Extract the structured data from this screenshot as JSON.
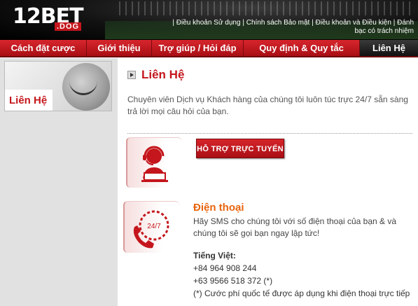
{
  "header": {
    "logo_main": "12BET",
    "logo_sub": ".DOG",
    "links": [
      "Điều khoản Sử dụng",
      "Chính sách Bảo mật",
      "Điều khoản và Điều kiện",
      "Đánh bạc có trách nhiệm"
    ]
  },
  "nav": {
    "items": [
      "Cách đặt cược",
      "Giới thiệu",
      "Trợ giúp / Hỏi đáp",
      "Quy định & Quy tắc",
      "Liên Hệ"
    ],
    "active": "Liên Hệ"
  },
  "sidebar": {
    "banner_label": "Liên Hệ"
  },
  "main": {
    "title": "Liên Hệ",
    "intro": "Chuyên viên Dịch vụ Khách hàng của chúng tôi luôn túc trực 24/7 sẵn sàng trả lời mọi câu hỏi của bạn.",
    "live_chat_button": "HỖ TRỢ TRỰC TUYẾN",
    "phone_icon_text": "24/7",
    "phone_title": "Điện thoại",
    "phone_desc": "Hãy SMS cho chúng tôi với số điện thoại của bạn & và chúng tôi sẽ gọi bạn ngay lập tức!",
    "lang_label": "Tiếng Việt:",
    "numbers": [
      "+84 964 908 244",
      "+63 9566 518 372 (*)"
    ],
    "note": "(*) Cước phí quốc tế được áp dụng khi điện thoại trực tiếp"
  },
  "colors": {
    "brand_red": "#c4161c",
    "orange": "#e8640c"
  },
  "icons": [
    "arrow-right-icon",
    "support-agent-icon",
    "phone-24-7-icon"
  ]
}
